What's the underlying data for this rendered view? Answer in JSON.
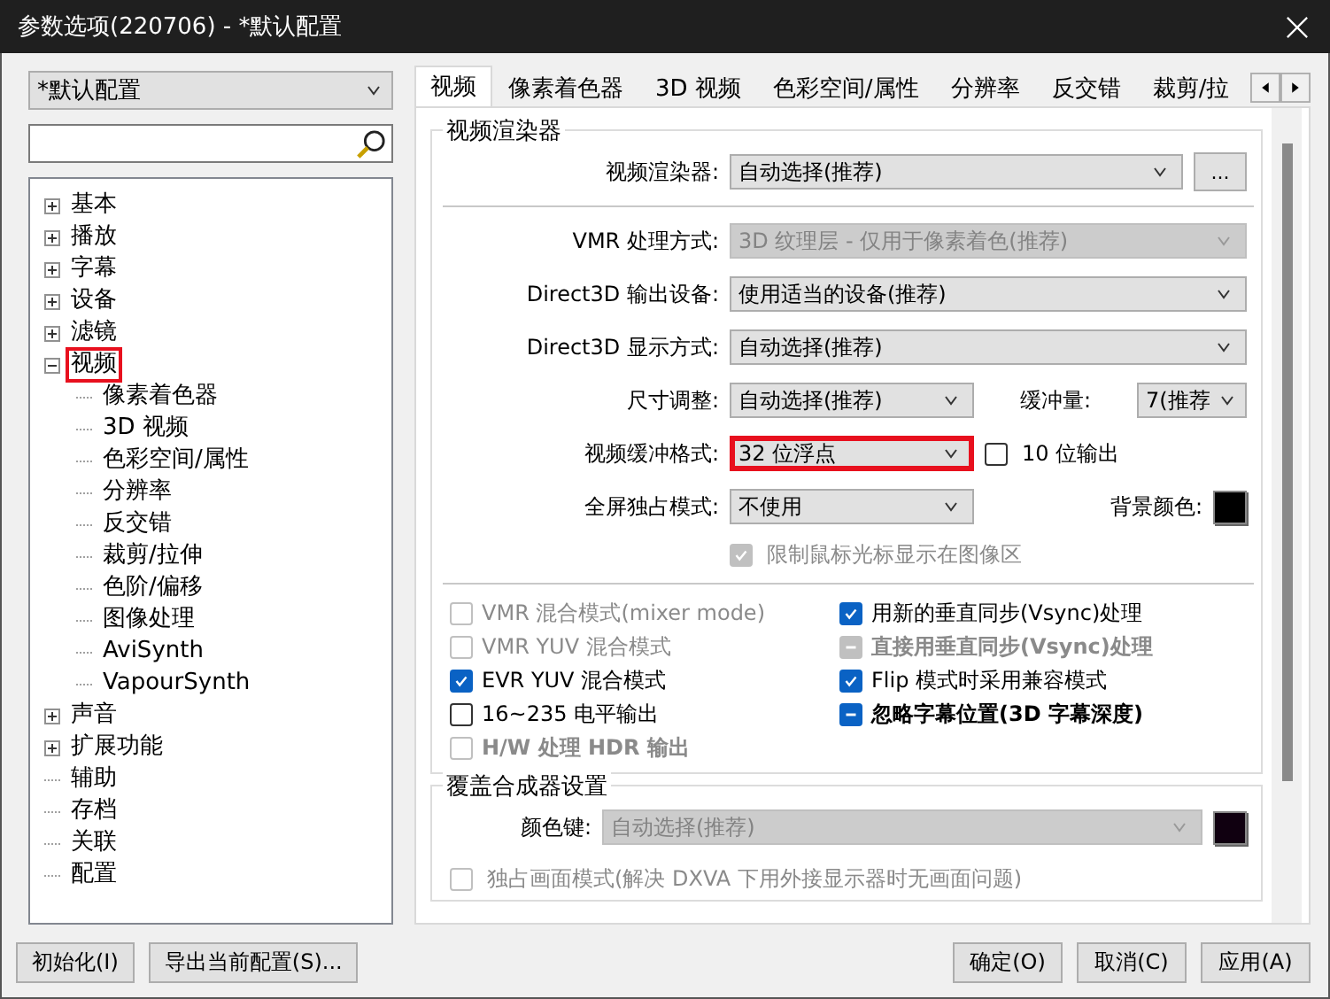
{
  "window": {
    "title": "参数选项(220706) - *默认配置"
  },
  "profile_select": {
    "value": "*默认配置"
  },
  "tree": [
    {
      "label": "基本",
      "kind": "folder",
      "expanded": false,
      "highlighted": false
    },
    {
      "label": "播放",
      "kind": "folder",
      "expanded": false,
      "highlighted": false
    },
    {
      "label": "字幕",
      "kind": "folder",
      "expanded": false,
      "highlighted": false
    },
    {
      "label": "设备",
      "kind": "folder",
      "expanded": false,
      "highlighted": false
    },
    {
      "label": "滤镜",
      "kind": "folder",
      "expanded": false,
      "highlighted": false
    },
    {
      "label": "视频",
      "kind": "folder",
      "expanded": true,
      "highlighted": true,
      "children": [
        {
          "label": "像素着色器"
        },
        {
          "label": "3D 视频"
        },
        {
          "label": "色彩空间/属性"
        },
        {
          "label": "分辨率"
        },
        {
          "label": "反交错"
        },
        {
          "label": "裁剪/拉伸"
        },
        {
          "label": "色阶/偏移"
        },
        {
          "label": "图像处理"
        },
        {
          "label": "AviSynth"
        },
        {
          "label": "VapourSynth"
        }
      ]
    },
    {
      "label": "声音",
      "kind": "folder",
      "expanded": false,
      "highlighted": false
    },
    {
      "label": "扩展功能",
      "kind": "folder",
      "expanded": false,
      "highlighted": false
    },
    {
      "label": "辅助",
      "kind": "leaf",
      "highlighted": false
    },
    {
      "label": "存档",
      "kind": "leaf",
      "highlighted": false
    },
    {
      "label": "关联",
      "kind": "leaf",
      "highlighted": false
    },
    {
      "label": "配置",
      "kind": "leaf",
      "highlighted": false
    }
  ],
  "tabs": [
    {
      "label": "视频",
      "selected": true
    },
    {
      "label": "像素着色器",
      "selected": false
    },
    {
      "label": "3D 视频",
      "selected": false
    },
    {
      "label": "色彩空间/属性",
      "selected": false
    },
    {
      "label": "分辨率",
      "selected": false
    },
    {
      "label": "反交错",
      "selected": false
    },
    {
      "label": "裁剪/拉",
      "selected": false
    }
  ],
  "renderer_group": {
    "title": "视频渲染器",
    "renderer": {
      "label": "视频渲染器:",
      "value": "自动选择(推荐)",
      "more": "..."
    },
    "full_rows": [
      {
        "label": "VMR 处理方式:",
        "value": "3D 纹理层 - 仅用于像素着色(推荐)",
        "disabled": true
      },
      {
        "label": "Direct3D 输出设备:",
        "value": "使用适当的设备(推荐)",
        "disabled": false
      },
      {
        "label": "Direct3D 显示方式:",
        "value": "自动选择(推荐)",
        "disabled": false
      }
    ],
    "split_rows": [
      {
        "label": "尺寸调整:",
        "value": "自动选择(推荐)",
        "highlighted": false,
        "side": {
          "kind": "dropdown",
          "label": "缓冲量:",
          "value": "7(推荐"
        }
      },
      {
        "label": "视频缓冲格式:",
        "value": "32 位浮点",
        "highlighted": true,
        "side": {
          "kind": "checkbox",
          "label": "10 位输出",
          "checked": false
        }
      },
      {
        "label": "全屏独占模式:",
        "value": "不使用",
        "highlighted": false,
        "side": {
          "kind": "color",
          "label": "背景颜色:",
          "color": "#000000"
        }
      }
    ],
    "cursor_option": {
      "label": "限制鼠标光标显示在图像区",
      "checked": true,
      "disabled": true
    },
    "options_left": [
      {
        "label": "VMR 混合模式(mixer mode)",
        "checked": false,
        "indeterminate": false,
        "disabled": true,
        "bold": false
      },
      {
        "label": "VMR YUV 混合模式",
        "checked": false,
        "indeterminate": false,
        "disabled": true,
        "bold": false
      },
      {
        "label": "EVR YUV 混合模式",
        "checked": true,
        "indeterminate": false,
        "disabled": false,
        "bold": false
      },
      {
        "label": "16~235 电平输出",
        "checked": false,
        "indeterminate": false,
        "disabled": false,
        "bold": false
      },
      {
        "label": "H/W 处理 HDR 输出",
        "checked": false,
        "indeterminate": false,
        "disabled": true,
        "bold": true
      }
    ],
    "options_right": [
      {
        "label": "用新的垂直同步(Vsync)处理",
        "checked": true,
        "indeterminate": false,
        "disabled": false,
        "bold": false
      },
      {
        "label": "直接用垂直同步(Vsync)处理",
        "checked": true,
        "indeterminate": true,
        "disabled": true,
        "bold": true
      },
      {
        "label": "Flip 模式时采用兼容模式",
        "checked": true,
        "indeterminate": false,
        "disabled": false,
        "bold": false
      },
      {
        "label": "忽略字幕位置(3D 字幕深度)",
        "checked": true,
        "indeterminate": true,
        "disabled": false,
        "bold": true
      }
    ]
  },
  "overlay_group": {
    "title": "覆盖合成器设置",
    "color_key": {
      "label": "颜色键:",
      "value": "自动选择(推荐)",
      "disabled": true,
      "color": "#100010"
    }
  },
  "exclusive_option": {
    "label": "独占画面模式(解决 DXVA 下用外接显示器时无画面问题)",
    "checked": false,
    "disabled": true
  },
  "buttons_left": [
    "初始化(I)",
    "导出当前配置(S)..."
  ],
  "buttons_right": [
    "确定(O)",
    "取消(C)",
    "应用(A)"
  ]
}
